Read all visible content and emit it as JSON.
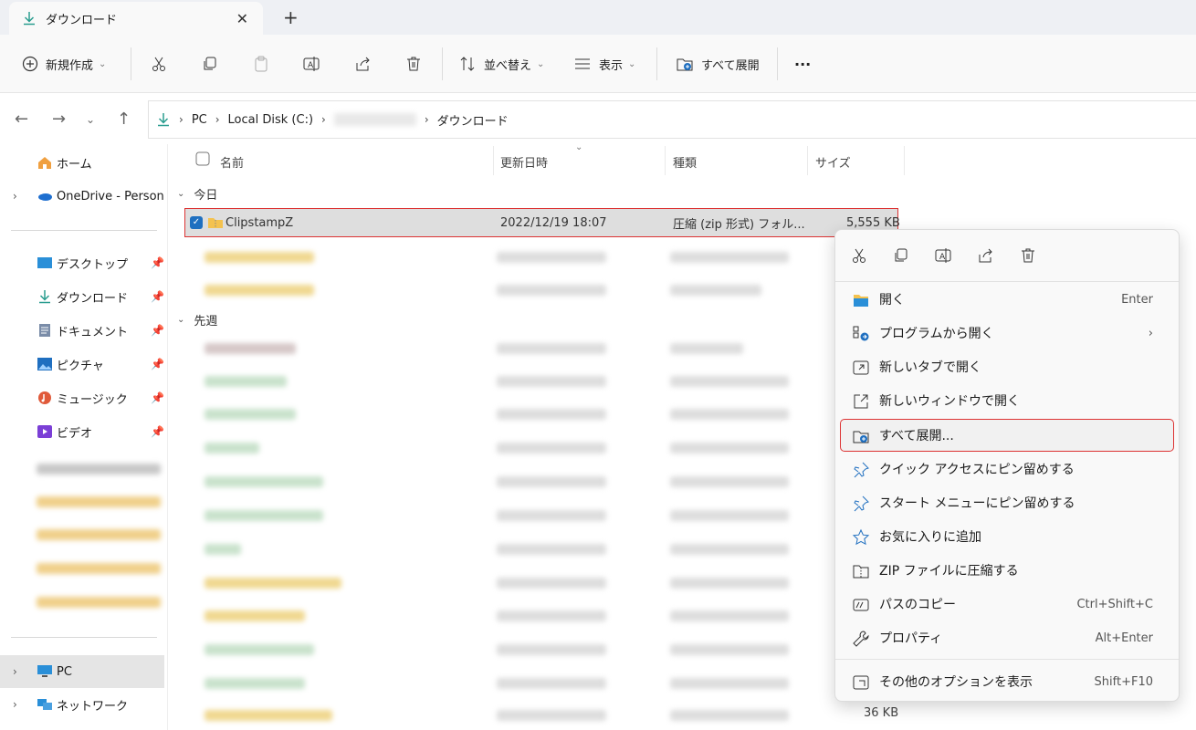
{
  "tab": {
    "title": "ダウンロード"
  },
  "toolbar": {
    "new_label": "新規作成",
    "sort_label": "並べ替え",
    "view_label": "表示",
    "extract_label": "すべて展開",
    "more_label": "···"
  },
  "address": {
    "pc": "PC",
    "disk": "Local Disk (C:)",
    "current": "ダウンロード"
  },
  "sidebar": {
    "home": "ホーム",
    "onedrive": "OneDrive - Persona",
    "desktop": "デスクトップ",
    "downloads": "ダウンロード",
    "documents": "ドキュメント",
    "pictures": "ピクチャ",
    "music": "ミュージック",
    "videos": "ビデオ",
    "pc": "PC",
    "network": "ネットワーク"
  },
  "columns": {
    "name": "名前",
    "modified": "更新日時",
    "type": "種類",
    "size": "サイズ"
  },
  "groups": {
    "today": "今日",
    "last_week": "先週"
  },
  "selected_file": {
    "name": "ClipstampZ",
    "modified": "2022/12/19 18:07",
    "type": "圧縮 (zip 形式) フォル...",
    "size": "5,555 KB"
  },
  "bottom_size": "36 KB",
  "context_menu": {
    "items": [
      {
        "label": "開く",
        "shortcut": "Enter"
      },
      {
        "label": "プログラムから開く",
        "shortcut": ""
      },
      {
        "label": "新しいタブで開く",
        "shortcut": ""
      },
      {
        "label": "新しいウィンドウで開く",
        "shortcut": ""
      },
      {
        "label": "すべて展開...",
        "shortcut": ""
      },
      {
        "label": "クイック アクセスにピン留めする",
        "shortcut": ""
      },
      {
        "label": "スタート メニューにピン留めする",
        "shortcut": ""
      },
      {
        "label": "お気に入りに追加",
        "shortcut": ""
      },
      {
        "label": "ZIP ファイルに圧縮する",
        "shortcut": ""
      },
      {
        "label": "パスのコピー",
        "shortcut": "Ctrl+Shift+C"
      },
      {
        "label": "プロパティ",
        "shortcut": "Alt+Enter"
      },
      {
        "label": "その他のオプションを表示",
        "shortcut": "Shift+F10"
      }
    ]
  },
  "colors": {
    "accent": "#1f6fc0",
    "highlight_border": "#dd3333",
    "folder": "#f4c24f"
  }
}
